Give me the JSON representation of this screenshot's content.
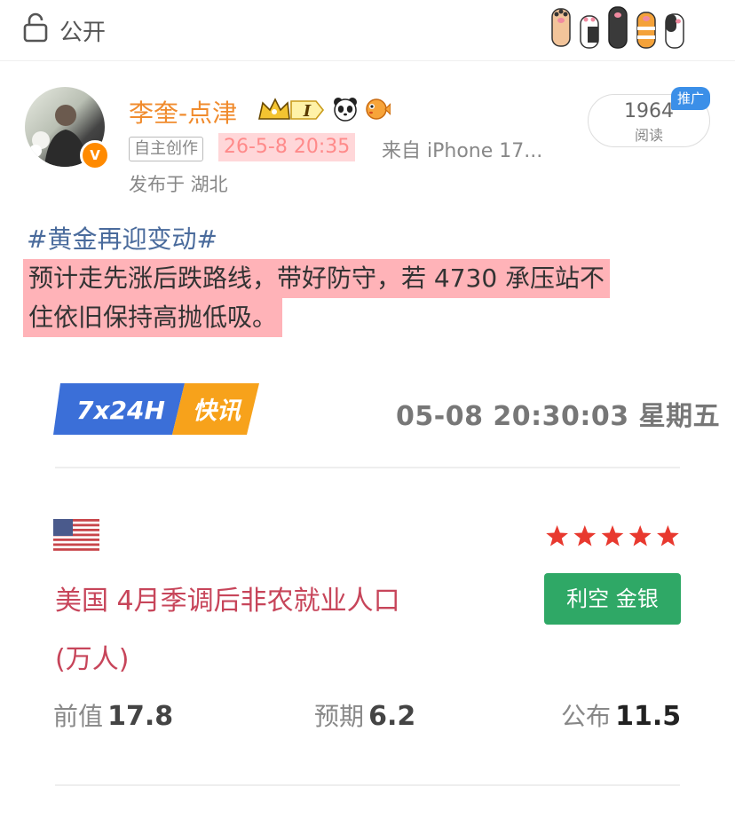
{
  "header": {
    "visibility_label": "公开"
  },
  "author": {
    "name": "李奎-点津",
    "level_badge": "I",
    "verified_mark": "V",
    "self_created_tag": "自主创作",
    "post_time": "26-5-8 20:35",
    "device": "来自 iPhone 17...",
    "location": "发布于 湖北"
  },
  "read_stats": {
    "count": "1964",
    "label": "阅读",
    "promo_tag": "推广"
  },
  "post": {
    "hashtag": "#黄金再迎变动#",
    "line1": "预计走先涨后跌路线，带好防守，若 4730 承压站不",
    "line2": "住依旧保持高抛低吸。"
  },
  "flash": {
    "badge_left": "7x24H",
    "badge_right": "快讯",
    "datetime": "05-08 20:30:03 星期五",
    "importance_stars": 5,
    "headline_line1": "美国 4月季调后非农就业人口",
    "headline_line2": "(万人)",
    "impact": "利空 金银",
    "previous_label": "前值",
    "previous_value": "17.8",
    "forecast_label": "预期",
    "forecast_value": "6.2",
    "actual_label": "公布",
    "actual_value": "11.5"
  },
  "colors": {
    "author_name": "#f08b2d",
    "highlight": "#ffb3b8",
    "hashtag": "#4a6b9c",
    "headline": "#c7455a",
    "impact_tag": "#2fa866",
    "star": "#e8392f",
    "badge_blue": "#3b6fd8",
    "badge_orange": "#f7a21b"
  },
  "icons": {
    "lock": "lock-icon",
    "paws": "cat-paws-decoration",
    "crown": "crown-badge-icon",
    "panda": "panda-icon",
    "fish": "pufferfish-icon",
    "flag": "us-flag-icon",
    "star": "star-icon"
  }
}
